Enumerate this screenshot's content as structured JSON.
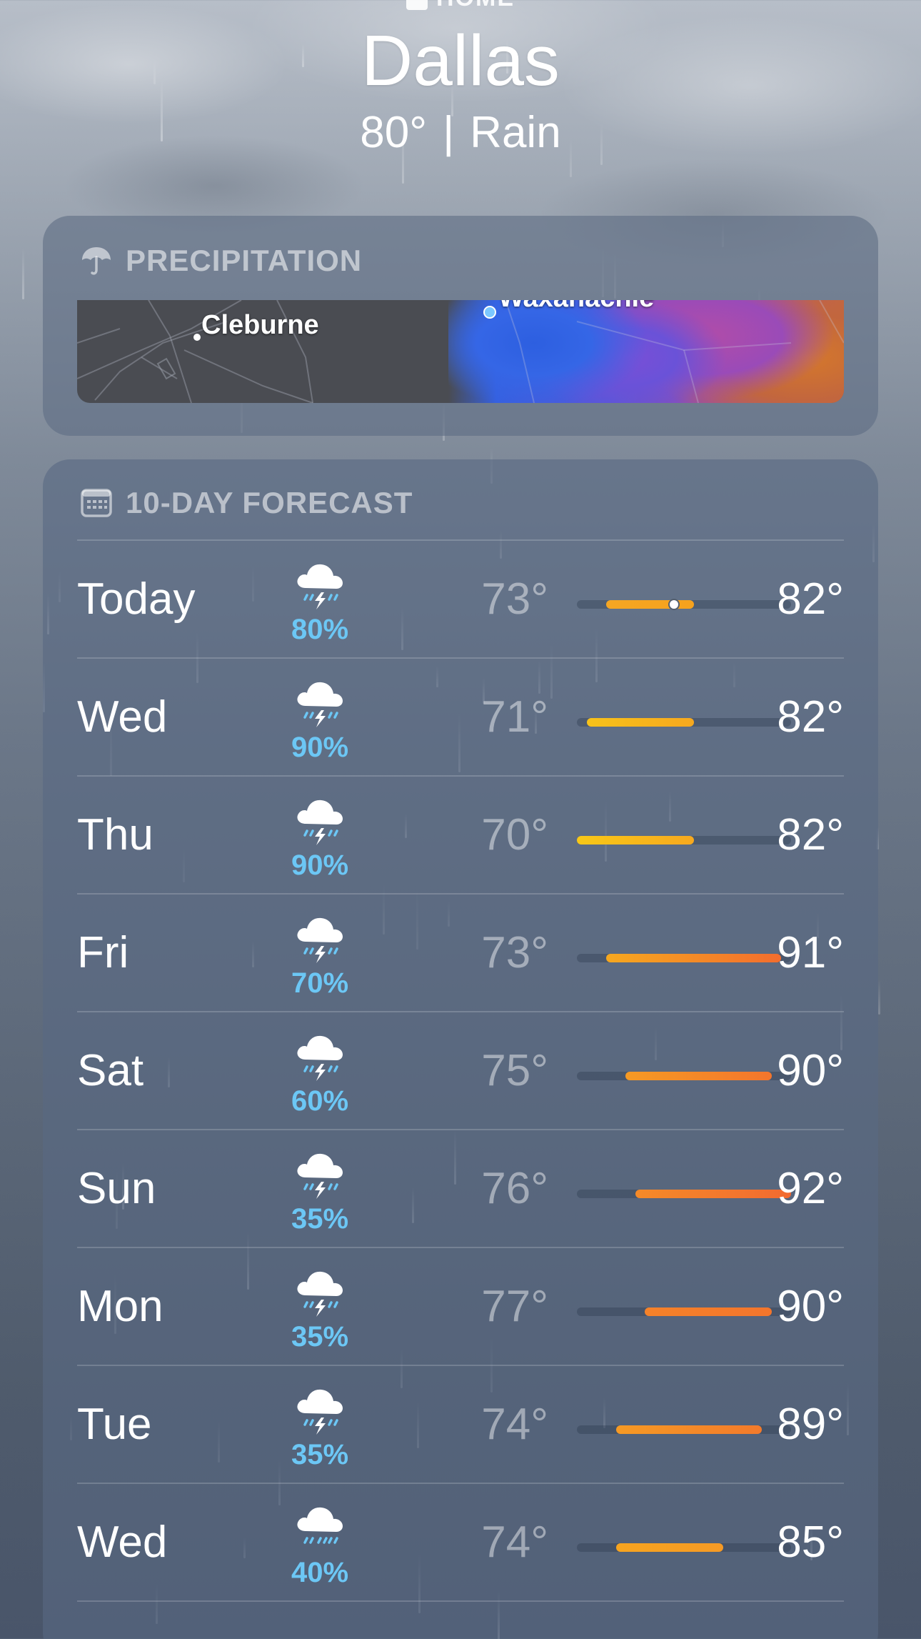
{
  "header": {
    "location_tag": "HOME",
    "city": "Dallas",
    "current_temp": "80°",
    "separator": "|",
    "condition": "Rain"
  },
  "precipitation": {
    "title": "PRECIPITATION",
    "icon": "umbrella-icon",
    "map_labels": {
      "city_1": "Cleburne",
      "city_2": "Waxahachie"
    }
  },
  "forecast": {
    "title": "10-DAY FORECAST",
    "icon": "calendar-icon",
    "range_min": 70,
    "range_max": 92,
    "current_temp": 80,
    "days": [
      {
        "day": "Today",
        "icon": "thunderstorm-icon",
        "precip": "80%",
        "low_label": "73°",
        "high_label": "82°",
        "low": 73,
        "high": 82,
        "show_now": true,
        "colors": [
          "#f5a623",
          "#f6a21d"
        ]
      },
      {
        "day": "Wed",
        "icon": "thunderstorm-icon",
        "precip": "90%",
        "low_label": "71°",
        "high_label": "82°",
        "low": 71,
        "high": 82,
        "show_now": false,
        "colors": [
          "#f7c21a",
          "#f6a81f"
        ]
      },
      {
        "day": "Thu",
        "icon": "thunderstorm-icon",
        "precip": "90%",
        "low_label": "70°",
        "high_label": "82°",
        "low": 70,
        "high": 82,
        "show_now": false,
        "colors": [
          "#f8c817",
          "#f7a91f"
        ]
      },
      {
        "day": "Fri",
        "icon": "thunderstorm-icon",
        "precip": "70%",
        "low_label": "73°",
        "high_label": "91°",
        "low": 73,
        "high": 91,
        "show_now": false,
        "colors": [
          "#f6a81f",
          "#f36d2e"
        ]
      },
      {
        "day": "Sat",
        "icon": "thunderstorm-icon",
        "precip": "60%",
        "low_label": "75°",
        "high_label": "90°",
        "low": 75,
        "high": 90,
        "show_now": false,
        "colors": [
          "#f69a24",
          "#f3752c"
        ]
      },
      {
        "day": "Sun",
        "icon": "thunderstorm-icon",
        "precip": "35%",
        "low_label": "76°",
        "high_label": "92°",
        "low": 76,
        "high": 92,
        "show_now": false,
        "colors": [
          "#f58a28",
          "#f26a30"
        ]
      },
      {
        "day": "Mon",
        "icon": "thunderstorm-icon",
        "precip": "35%",
        "low_label": "77°",
        "high_label": "90°",
        "low": 77,
        "high": 90,
        "show_now": false,
        "colors": [
          "#f5822a",
          "#f3752c"
        ]
      },
      {
        "day": "Tue",
        "icon": "thunderstorm-icon",
        "precip": "35%",
        "low_label": "74°",
        "high_label": "89°",
        "low": 74,
        "high": 89,
        "show_now": false,
        "colors": [
          "#f69a24",
          "#f37a2b"
        ]
      },
      {
        "day": "Wed",
        "icon": "rain-icon",
        "precip": "40%",
        "low_label": "74°",
        "high_label": "85°",
        "low": 74,
        "high": 85,
        "show_now": false,
        "colors": [
          "#f7a41f",
          "#f69a24"
        ]
      }
    ]
  }
}
